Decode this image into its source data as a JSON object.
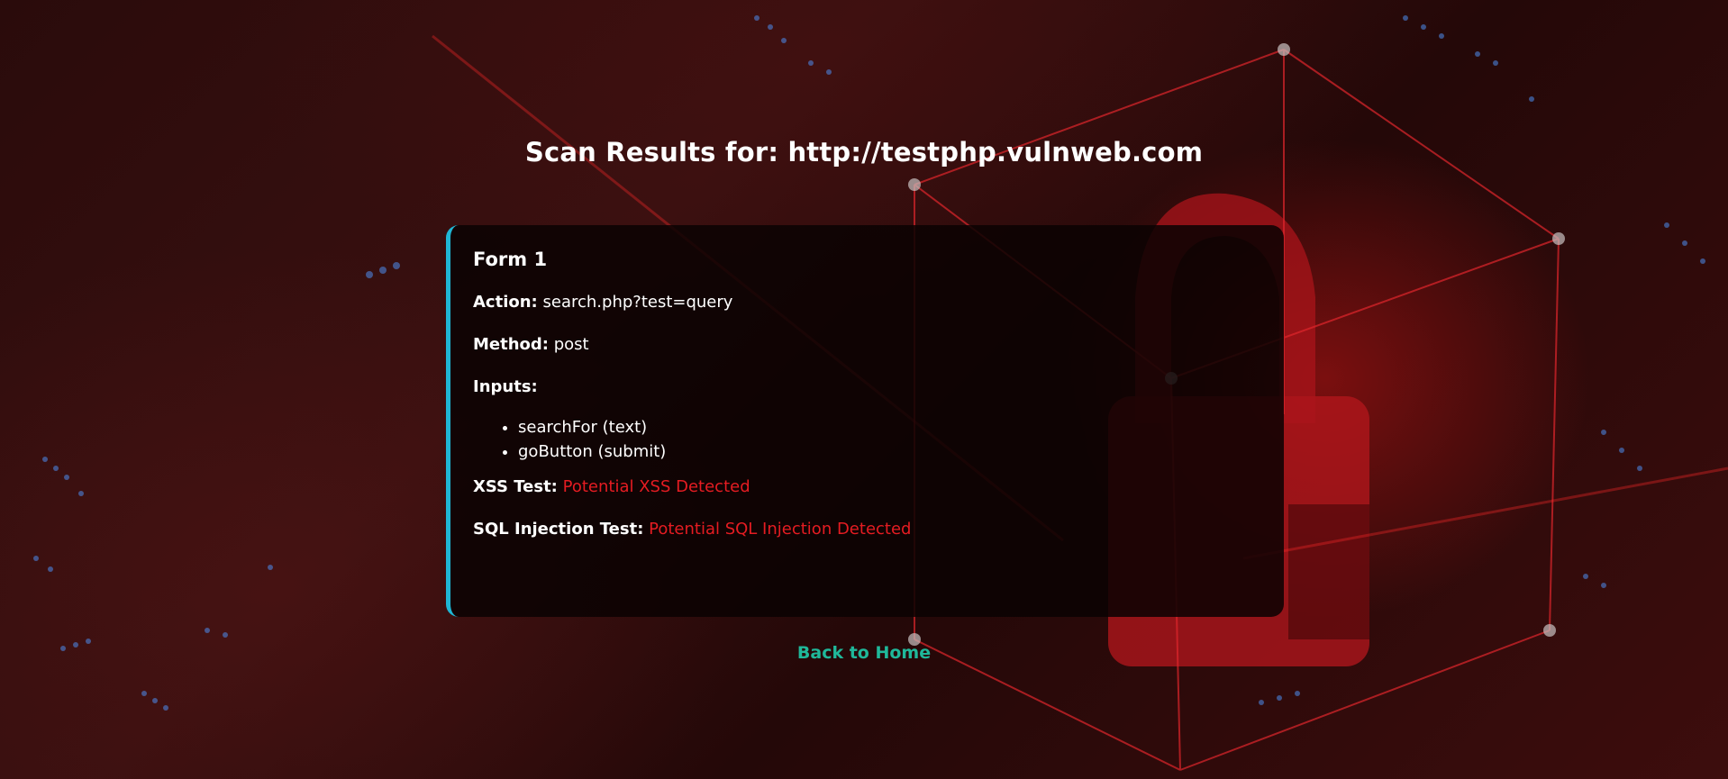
{
  "page": {
    "title": "Scan Results for: http://testphp.vulnweb.com"
  },
  "forms": [
    {
      "heading": "Form 1",
      "action_label": "Action:",
      "action_value": "search.php?test=query",
      "method_label": "Method:",
      "method_value": "post",
      "inputs_label": "Inputs:",
      "inputs": [
        "searchFor (text)",
        "goButton (submit)"
      ],
      "xss_label": "XSS Test:",
      "xss_result": "Potential XSS Detected",
      "sqli_label": "SQL Injection Test:",
      "sqli_result": "Potential SQL Injection Detected"
    }
  ],
  "nav": {
    "back_label": "Back to Home"
  },
  "colors": {
    "card_accent": "#1fb6d4",
    "danger": "#e51c22",
    "link": "#1fb89a",
    "background": "#2a0b0b"
  }
}
